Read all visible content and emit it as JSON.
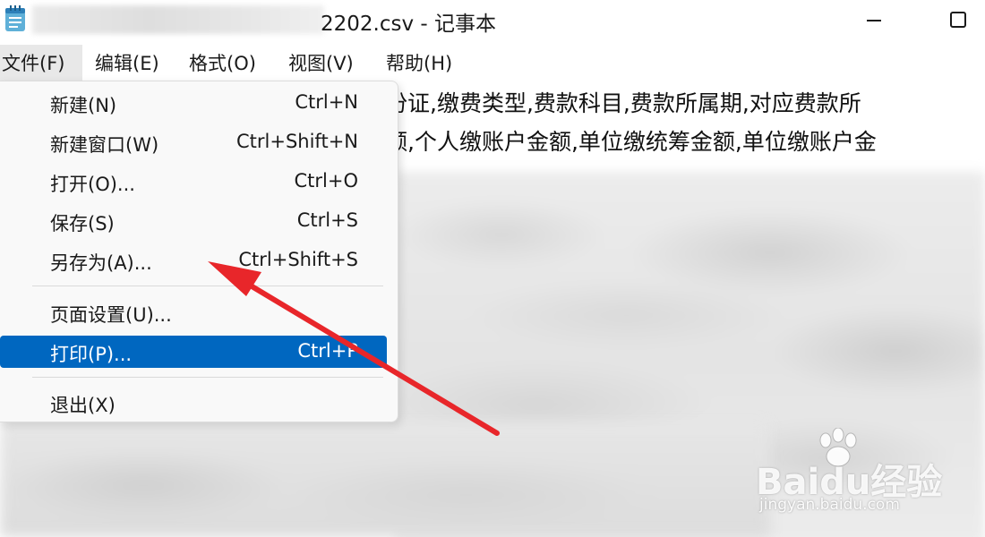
{
  "titlebar": {
    "title": "2202.csv - 记事本",
    "app_icon": "notepad-icon"
  },
  "menubar": {
    "items": [
      {
        "label": "文件(F)"
      },
      {
        "label": "编辑(E)"
      },
      {
        "label": "格式(O)"
      },
      {
        "label": "视图(V)"
      },
      {
        "label": "帮助(H)"
      }
    ]
  },
  "file_menu": {
    "items": [
      {
        "label": "新建(N)",
        "shortcut": "Ctrl+N"
      },
      {
        "label": "新建窗口(W)",
        "shortcut": "Ctrl+Shift+N"
      },
      {
        "label": "打开(O)...",
        "shortcut": "Ctrl+O"
      },
      {
        "label": "保存(S)",
        "shortcut": "Ctrl+S"
      },
      {
        "label": "另存为(A)...",
        "shortcut": "Ctrl+Shift+S"
      },
      {
        "label": "页面设置(U)...",
        "shortcut": ""
      },
      {
        "label": "打印(P)...",
        "shortcut": "Ctrl+P"
      },
      {
        "label": "退出(X)",
        "shortcut": ""
      }
    ],
    "highlight_color": "#0067c0"
  },
  "document": {
    "lines": [
      "份证,缴费类型,费款科目,费款所属期,对应费款所",
      "额,个人缴账户金额,单位缴统筹金额,单位缴账户金"
    ]
  },
  "annotation": {
    "arrow_color": "#e8262a"
  },
  "watermark": {
    "logo": "Baidu经验",
    "url": "jingyan.baidu.com"
  }
}
